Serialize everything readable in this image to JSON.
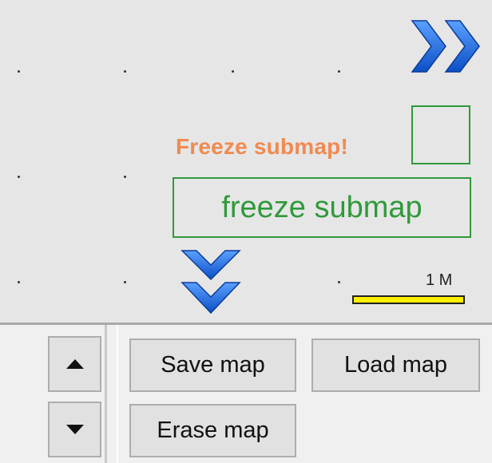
{
  "map": {
    "freeze_label": "Freeze submap!",
    "freeze_button": "freeze submap",
    "scale_label": "1 M",
    "colors": {
      "freeze_label": "#f08a50",
      "freeze_button": "#2f9a3a",
      "scale_bar": "#ffef00",
      "chevrons": "#1f66e0"
    },
    "icons": {
      "expand_right": "double-chevron-right-icon",
      "expand_down": "double-chevron-down-icon"
    }
  },
  "controls": {
    "up_icon": "triangle-up-icon",
    "down_icon": "triangle-down-icon",
    "save_label": "Save map",
    "load_label": "Load map",
    "erase_label": "Erase map"
  }
}
